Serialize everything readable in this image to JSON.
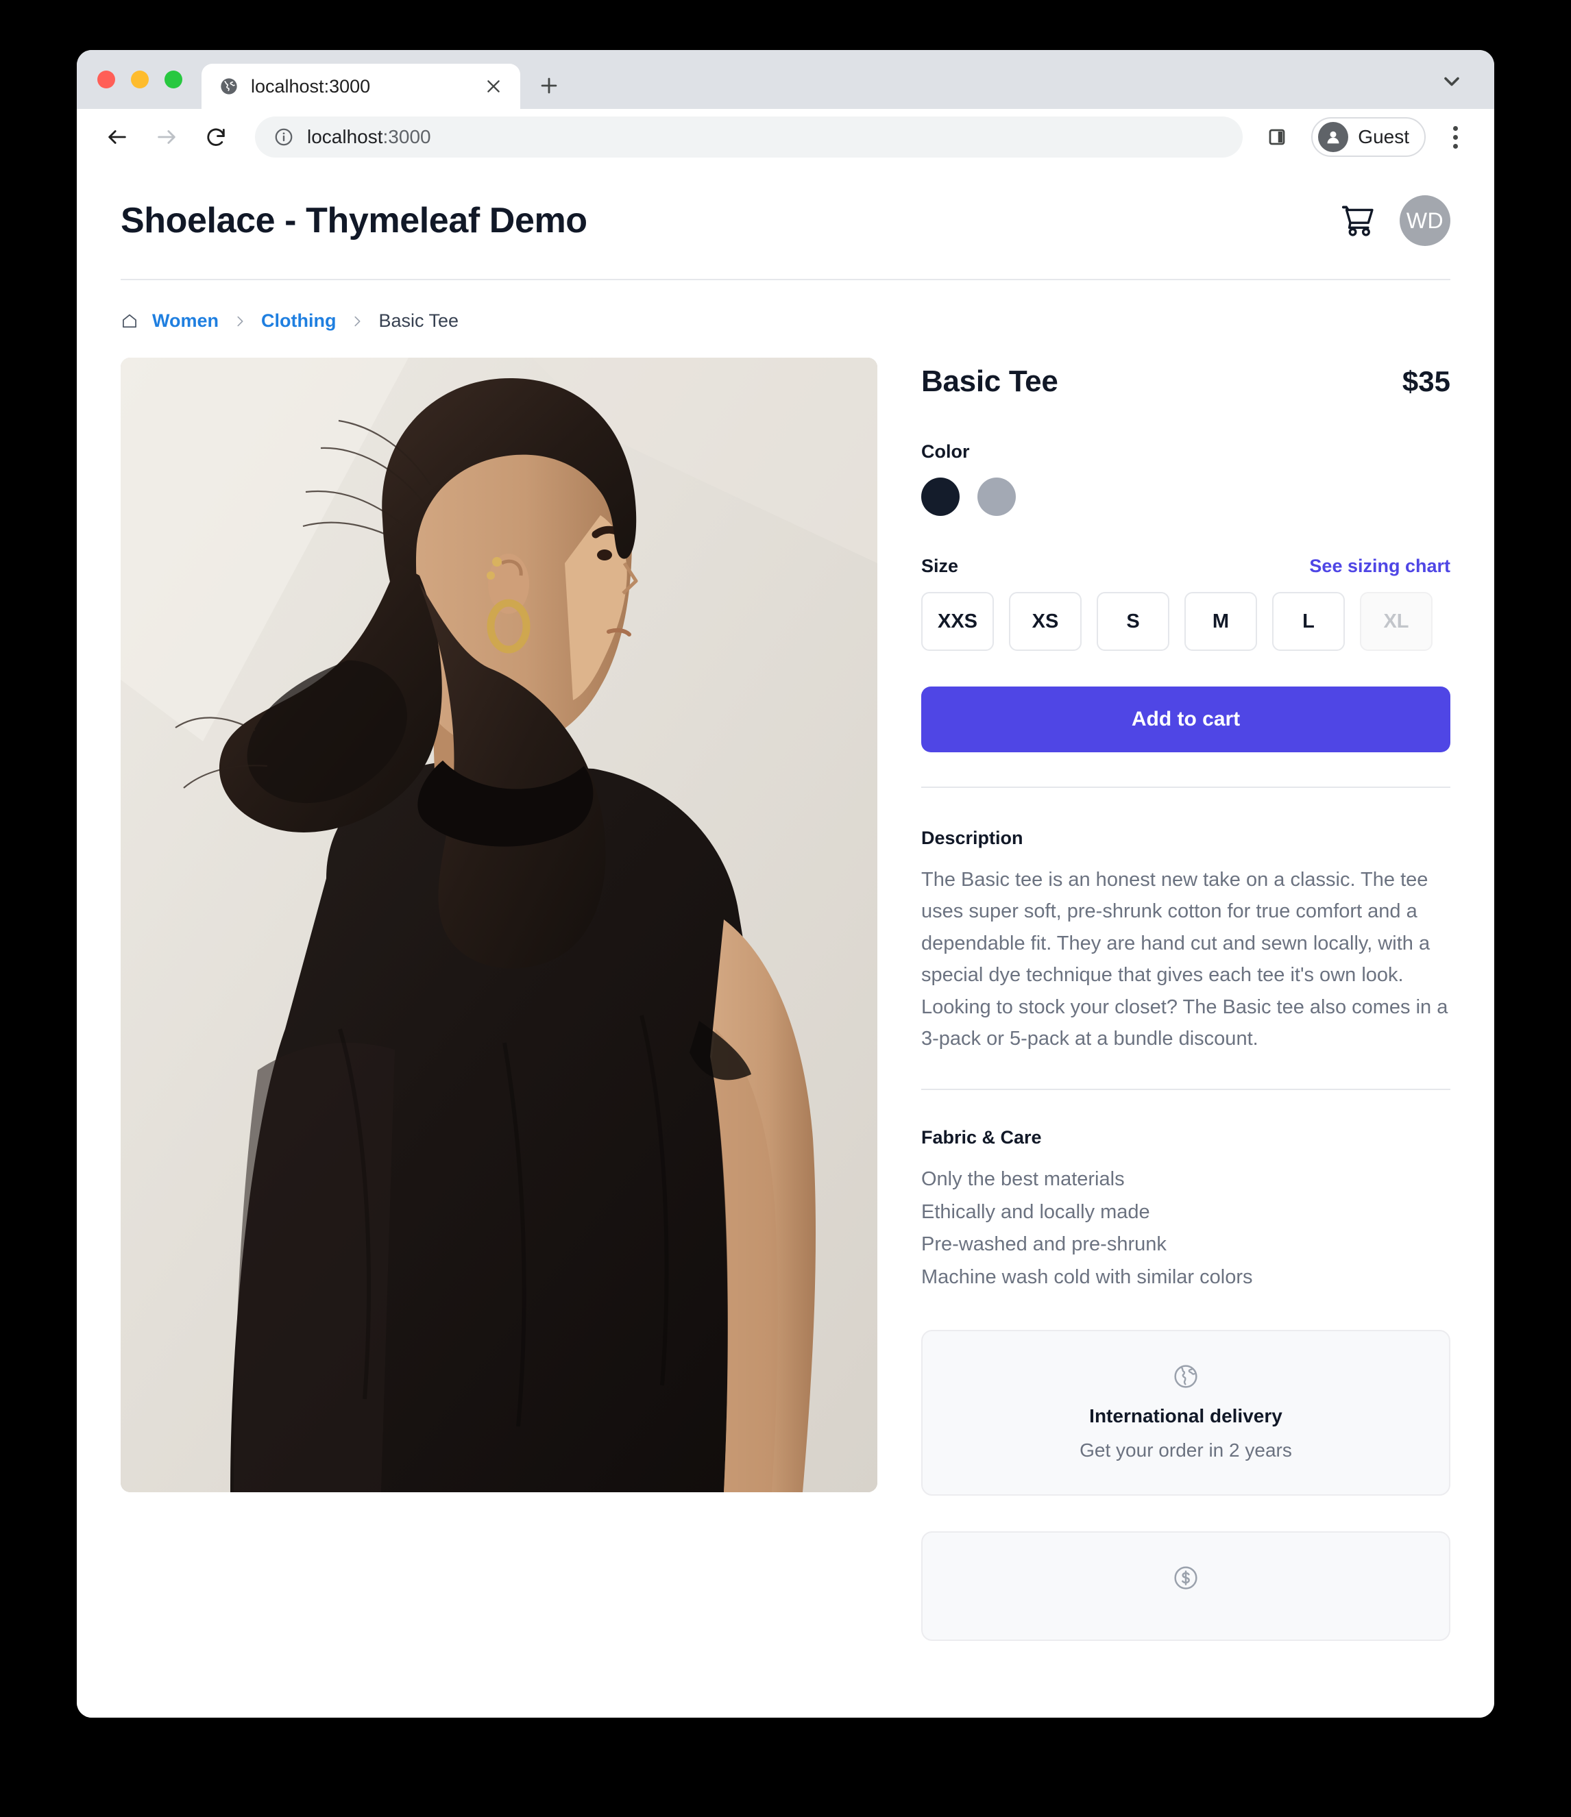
{
  "browser": {
    "tab": {
      "title": "localhost:3000",
      "favicon_icon": "globe-favicon-icon",
      "close_icon": "close-icon"
    },
    "new_tab_label": "+",
    "tabstrip_chevron_icon": "chevron-down-icon",
    "toolbar": {
      "back_icon": "back-arrow-icon",
      "forward_icon": "forward-arrow-icon",
      "reload_icon": "reload-icon",
      "info_icon": "info-circle-icon",
      "url_host": "localhost",
      "url_port": ":3000",
      "side_panel_icon": "side-panel-icon",
      "profile_label": "Guest",
      "profile_avatar_icon": "person-icon",
      "menu_icon": "kebab-menu-icon"
    },
    "traffic_lights": {
      "close": "#ff5f57",
      "minimize": "#febc2e",
      "maximize": "#28c840"
    }
  },
  "site": {
    "title": "Shoelace - Thymeleaf Demo",
    "cart_icon": "shopping-cart-icon",
    "avatar_initials": "WD"
  },
  "breadcrumb": {
    "home_icon": "home-icon",
    "separator": "›",
    "items": [
      {
        "label": "Women",
        "type": "link"
      },
      {
        "label": "Clothing",
        "type": "link"
      },
      {
        "label": "Basic Tee",
        "type": "current"
      }
    ]
  },
  "product": {
    "image_alt": "Woman photographed from behind wearing a black basic tee",
    "name": "Basic Tee",
    "price": "$35",
    "color": {
      "label": "Color",
      "options": [
        {
          "name": "Black",
          "hex": "#141c2b",
          "selected": true
        },
        {
          "name": "Heather Gray",
          "hex": "#a3a9b4",
          "selected": false
        }
      ]
    },
    "size": {
      "label": "Size",
      "sizing_chart_link": "See sizing chart",
      "options": [
        {
          "label": "XXS",
          "disabled": false
        },
        {
          "label": "XS",
          "disabled": false
        },
        {
          "label": "S",
          "disabled": false
        },
        {
          "label": "M",
          "disabled": false
        },
        {
          "label": "L",
          "disabled": false
        },
        {
          "label": "XL",
          "disabled": true
        }
      ]
    },
    "add_to_cart_label": "Add to cart",
    "description": {
      "heading": "Description",
      "paragraphs": [
        "The Basic tee is an honest new take on a classic. The tee uses super soft, pre-shrunk cotton for true comfort and a dependable fit. They are hand cut and sewn locally, with a special dye technique that gives each tee it's own look.",
        "Looking to stock your closet? The Basic tee also comes in a 3-pack or 5-pack at a bundle discount."
      ]
    },
    "fabric_care": {
      "heading": "Fabric & Care",
      "items": [
        "Only the best materials",
        "Ethically and locally made",
        "Pre-washed and pre-shrunk",
        "Machine wash cold with similar colors"
      ]
    },
    "features": [
      {
        "icon": "globe-icon",
        "title": "International delivery",
        "subtitle": "Get your order in 2 years"
      },
      {
        "icon": "currency-dollar-icon",
        "title": "",
        "subtitle": ""
      }
    ]
  },
  "colors": {
    "accent": "#4f46e5",
    "link": "#1f7fe0",
    "text": "#111827",
    "muted": "#6b7280",
    "border": "#e5e7eb"
  }
}
